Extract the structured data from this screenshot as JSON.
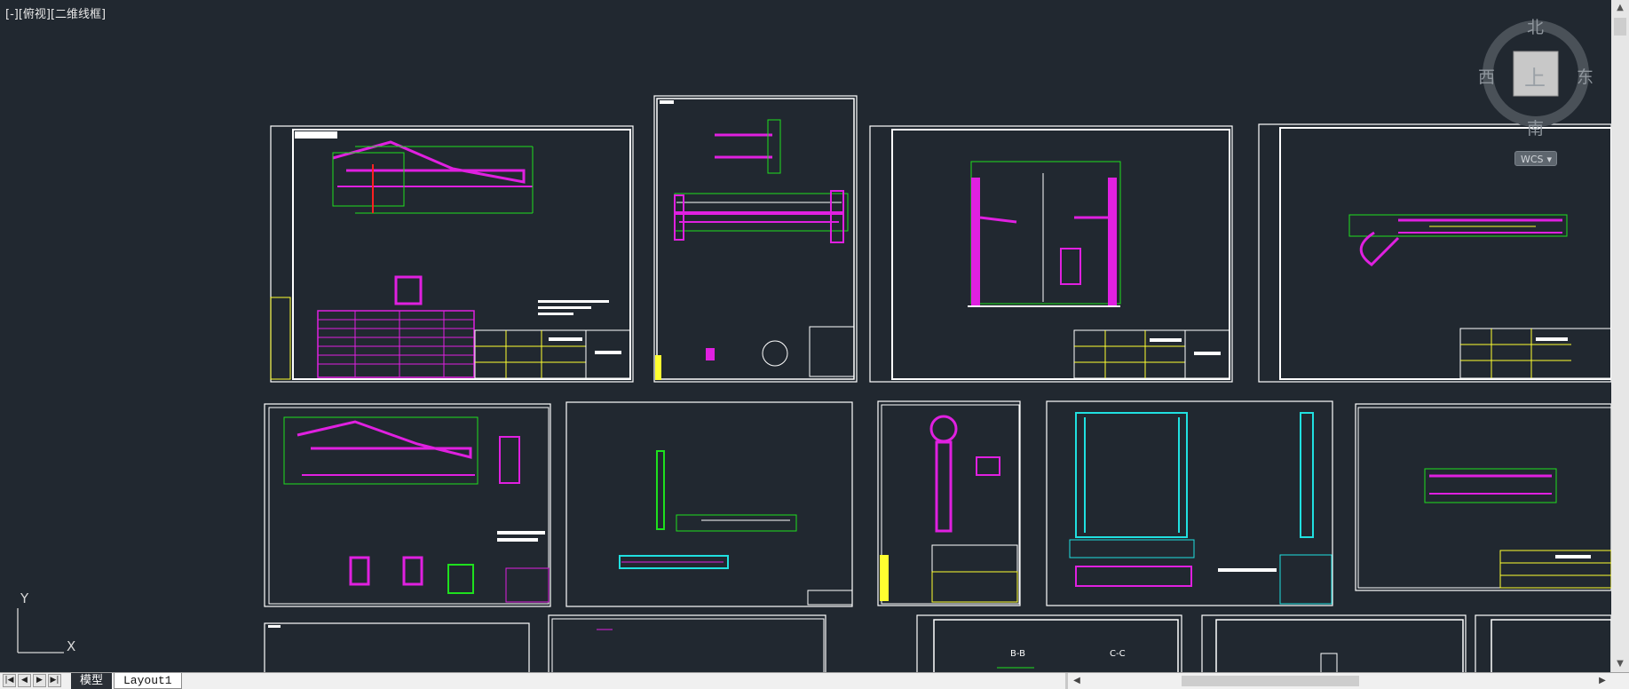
{
  "viewport": {
    "label": "[-][俯视][二维线框]"
  },
  "viewcube": {
    "north": "北",
    "south": "南",
    "east": "东",
    "west": "西",
    "face": "上",
    "wcs_label": "WCS"
  },
  "ucs": {
    "x_label": "X",
    "y_label": "Y"
  },
  "tabs": {
    "model": "模型",
    "layout1": "Layout1"
  },
  "icons": {
    "nav_first": "first-icon",
    "nav_prev": "prev-icon",
    "nav_next": "next-icon",
    "nav_last": "last-icon",
    "scroll_up": "up-arrow-icon",
    "scroll_down": "down-arrow-icon",
    "scroll_left": "left-arrow-icon",
    "scroll_right": "right-arrow-icon"
  },
  "drawing_labels": {
    "bb_section": "B-B",
    "cc_section": "C-C"
  },
  "colors": {
    "background": "#212830",
    "frame": "#ffffff",
    "green": "#1ee01e",
    "magenta": "#e020e0",
    "red": "#ff2020",
    "cyan": "#20e0e0",
    "yellow": "#ffff30"
  }
}
